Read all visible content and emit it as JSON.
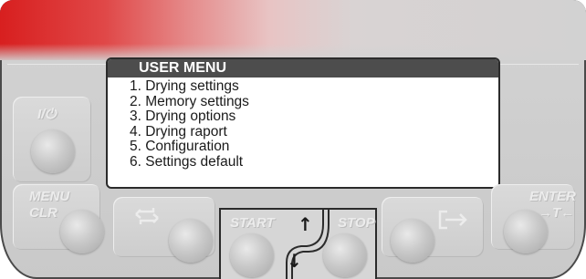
{
  "menu": {
    "title": "USER MENU",
    "items": [
      "1. Drying settings",
      "2. Memory settings",
      "3. Drying options",
      "4. Drying raport",
      "5. Configuration",
      "6. Settings default"
    ]
  },
  "buttons": {
    "power_label": "I/⏻",
    "menu_label": "MENU",
    "clr_label": "CLR",
    "start_label": "START",
    "stop_label": "STOP",
    "enter_label": "ENTER",
    "tare_label": "→T←"
  },
  "arrows": {
    "up": "↑",
    "down": "↓"
  },
  "icons": {
    "power": "power-icon",
    "swap": "swap-icon",
    "export": "export-icon",
    "up": "arrow-up-icon",
    "down": "arrow-down-icon"
  },
  "colors": {
    "accent_red": "#d81f1f",
    "panel_gray": "#cfcfcf",
    "title_bar": "#4d4d4d"
  }
}
